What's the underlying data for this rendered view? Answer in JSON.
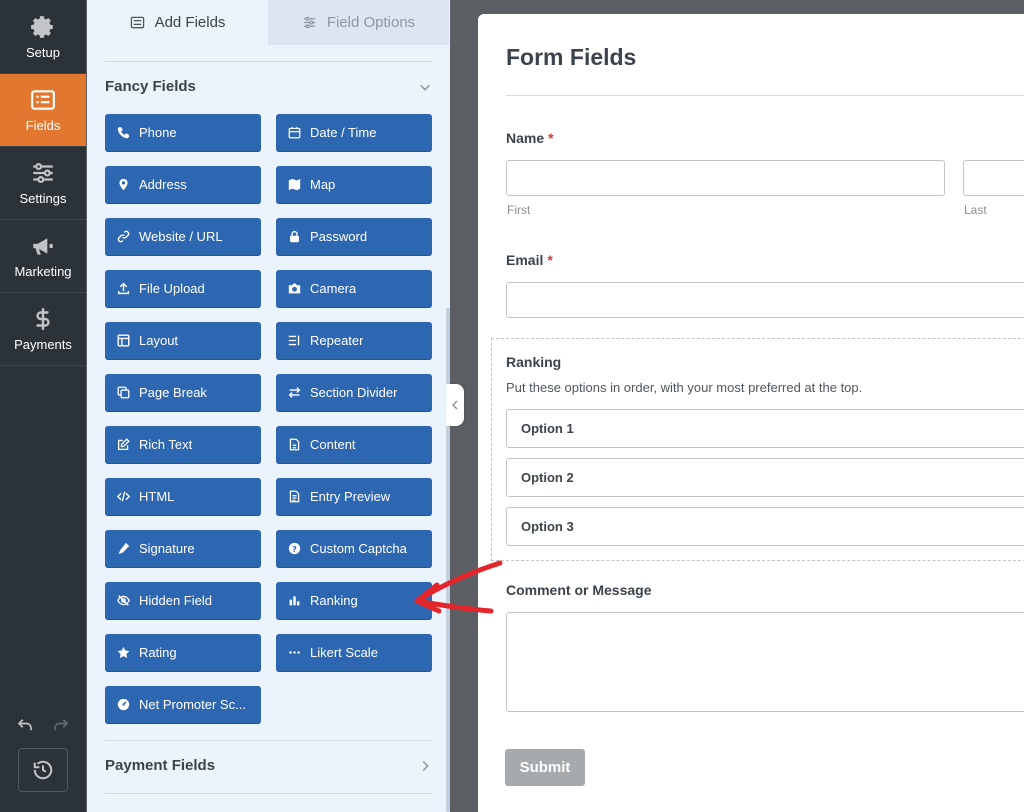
{
  "nav": {
    "items": [
      {
        "label": "Setup",
        "icon": "gear-icon"
      },
      {
        "label": "Fields",
        "icon": "list-icon",
        "active": true
      },
      {
        "label": "Settings",
        "icon": "sliders-icon"
      },
      {
        "label": "Marketing",
        "icon": "megaphone-icon"
      },
      {
        "label": "Payments",
        "icon": "dollar-icon"
      }
    ]
  },
  "panel": {
    "tabs": [
      {
        "label": "Add Fields",
        "active": true
      },
      {
        "label": "Field Options",
        "active": false
      }
    ],
    "fancy_section_title": "Fancy Fields",
    "fields": [
      {
        "label": "Phone",
        "icon": "phone-icon"
      },
      {
        "label": "Date / Time",
        "icon": "calendar-icon"
      },
      {
        "label": "Address",
        "icon": "map-pin-icon"
      },
      {
        "label": "Map",
        "icon": "map-icon"
      },
      {
        "label": "Website / URL",
        "icon": "link-icon"
      },
      {
        "label": "Password",
        "icon": "lock-icon"
      },
      {
        "label": "File Upload",
        "icon": "upload-icon"
      },
      {
        "label": "Camera",
        "icon": "camera-icon"
      },
      {
        "label": "Layout",
        "icon": "layout-icon"
      },
      {
        "label": "Repeater",
        "icon": "repeater-icon"
      },
      {
        "label": "Page Break",
        "icon": "copy-icon"
      },
      {
        "label": "Section Divider",
        "icon": "arrows-icon"
      },
      {
        "label": "Rich Text",
        "icon": "edit-icon"
      },
      {
        "label": "Content",
        "icon": "file-icon"
      },
      {
        "label": "HTML",
        "icon": "code-icon"
      },
      {
        "label": "Entry Preview",
        "icon": "document-icon"
      },
      {
        "label": "Signature",
        "icon": "pen-icon"
      },
      {
        "label": "Custom Captcha",
        "icon": "question-icon"
      },
      {
        "label": "Hidden Field",
        "icon": "eye-off-icon"
      },
      {
        "label": "Ranking",
        "icon": "bar-chart-icon"
      },
      {
        "label": "Rating",
        "icon": "star-icon"
      },
      {
        "label": "Likert Scale",
        "icon": "dots-icon"
      },
      {
        "label": "Net Promoter Sc...",
        "icon": "gauge-icon"
      }
    ],
    "payment_section_title": "Payment Fields"
  },
  "form": {
    "title": "Form Fields",
    "name_label": "Name",
    "required_mark": "*",
    "first_label": "First",
    "last_label": "Last",
    "email_label": "Email",
    "ranking_label": "Ranking",
    "ranking_desc": "Put these options in order, with your most preferred at the top.",
    "options": [
      "Option 1",
      "Option 2",
      "Option 3"
    ],
    "comment_label": "Comment or Message",
    "submit_label": "Submit"
  },
  "colors": {
    "nav_bg": "#2c3338",
    "nav_active": "#e27730",
    "field_button": "#2e67b1",
    "panel_bg": "#ebf3fc",
    "annotation_arrow": "#e3262b"
  }
}
